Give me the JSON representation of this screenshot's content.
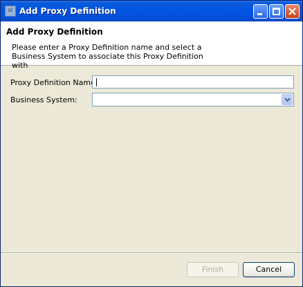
{
  "window": {
    "title": "Add Proxy Definition",
    "icon": "app-window-icon",
    "icon_text": "SE"
  },
  "header": {
    "title": "Add Proxy Definition",
    "description": "Please enter a Proxy Definition name and select a Business System to associate this Proxy Definition with"
  },
  "form": {
    "proxy_name_label": "Proxy Definition Name:",
    "proxy_name_value": "",
    "business_system_label": "Business System:",
    "business_system_value": ""
  },
  "buttons": {
    "finish": "Finish",
    "cancel": "Cancel"
  },
  "colors": {
    "title_bar": "#0054e3",
    "dialog_bg": "#ece9d8",
    "input_border": "#7f9db9"
  }
}
